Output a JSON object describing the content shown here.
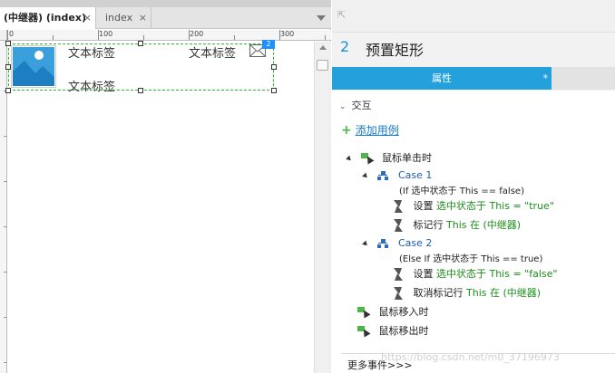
{
  "document_tabs": [
    {
      "label": "(中继器) (index)",
      "active": true,
      "close": "×"
    },
    {
      "label": "index",
      "active": false,
      "close": "×"
    }
  ],
  "ruler": {
    "h_ticks": [
      "0",
      "100",
      "200",
      "300"
    ]
  },
  "canvas": {
    "labels": [
      "文本标签",
      "文本标签",
      "文本标签"
    ],
    "badge": "2"
  },
  "inspector": {
    "number": "2",
    "title": "预置矩形",
    "tab_label": "属性",
    "tab_star": "*",
    "section": "交互",
    "add_case": "添加用例",
    "events": [
      {
        "label": "鼠标单击时"
      },
      {
        "label": "鼠标移入时"
      },
      {
        "label": "鼠标移出时"
      }
    ],
    "case1": {
      "name": "Case 1",
      "condition": "(If 选中状态于 This == false)",
      "actions": [
        {
          "verb": "设置",
          "detail": "选中状态于 This = \"true\""
        },
        {
          "verb": "标记行",
          "detail": "This 在 (中继器)"
        }
      ]
    },
    "case2": {
      "name": "Case 2",
      "condition": "(Else If 选中状态于 This == true)",
      "actions": [
        {
          "verb": "设置",
          "detail": "选中状态于 This = \"false\""
        },
        {
          "verb": "取消标记行",
          "detail": "This 在 (中继器)"
        }
      ]
    },
    "more_events": "更多事件>>>"
  },
  "watermark": "https://blog.csdn.net/m0_37196973",
  "colors": {
    "accent": "#24a0dc",
    "green": "#1b8e1b",
    "repeater_border": "#2eb82e"
  }
}
